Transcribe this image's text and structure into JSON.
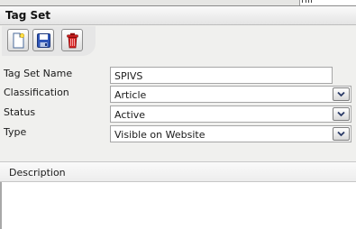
{
  "panel": {
    "title": "Tag Set"
  },
  "toolbar": {
    "buttons": [
      "new-icon",
      "save-icon",
      "delete-icon"
    ]
  },
  "form": {
    "name": {
      "label": "Tag Set Name",
      "value": "SPIVS"
    },
    "classification": {
      "label": "Classification",
      "value": "Article"
    },
    "status": {
      "label": "Status",
      "value": "Active"
    },
    "type": {
      "label": "Type",
      "value": "Visible on Website"
    }
  },
  "description": {
    "label": "Description",
    "value": ""
  }
}
